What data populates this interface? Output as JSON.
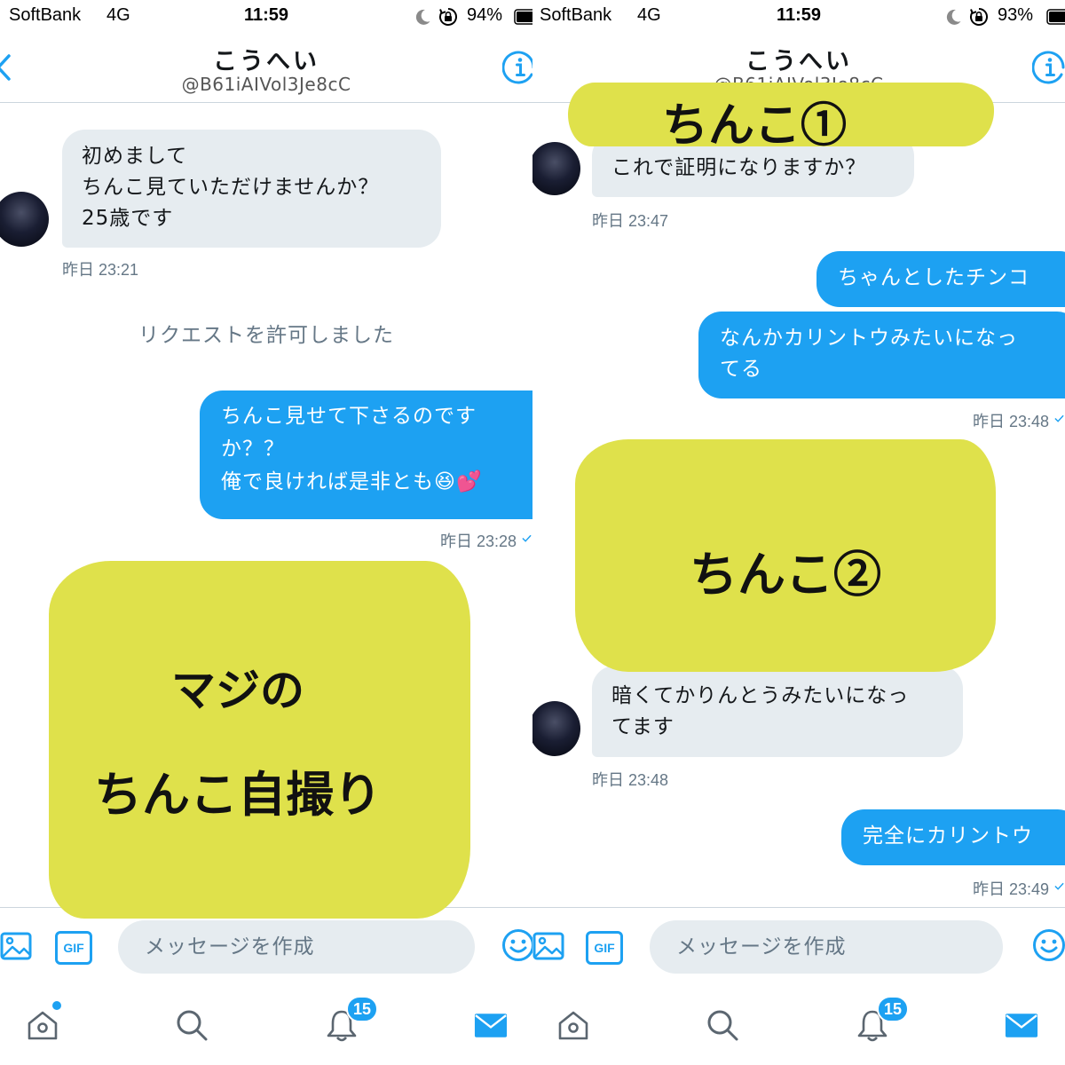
{
  "colors": {
    "accent": "#1da1f2",
    "incoming_bubble": "#e6ecf0",
    "highlighter": "#dfe14b",
    "secondary_text": "#657786"
  },
  "left_screen": {
    "status_bar": {
      "carrier": "SoftBank",
      "network": "4G",
      "time": "11:59",
      "battery": "94%"
    },
    "header": {
      "name": "こうへい",
      "handle": "@B61iAIVol3Je8cC"
    },
    "messages": [
      {
        "from_me": false,
        "lines": [
          "初めまして",
          "ちんこ見ていただけませんか？",
          "25歳です"
        ],
        "timestamp": "昨日 23:21"
      },
      {
        "system_text": "リクエストを許可しました"
      },
      {
        "from_me": true,
        "lines": [
          "ちんこ見せて下さるのです",
          "か？？",
          "俺で良ければ是非とも😆💕"
        ],
        "timestamp": "昨日 23:28",
        "status_icon": "sent-check-icon"
      }
    ],
    "highlighter_labels": [
      "マジの",
      "ちんこ自撮り"
    ],
    "composer": {
      "placeholder": "メッセージを作成",
      "gif_label": "GIF"
    },
    "tab_bar": {
      "notifications_badge": "15"
    }
  },
  "right_screen": {
    "status_bar": {
      "carrier": "SoftBank",
      "network": "4G",
      "time": "11:59",
      "battery": "93%"
    },
    "header": {
      "name": "こうへい",
      "handle": "@B61iAIVol3Je8cC"
    },
    "messages": [
      {
        "from_me": false,
        "lines": [
          "これで証明になりますか？"
        ],
        "timestamp": "昨日 23:47"
      },
      {
        "from_me": true,
        "lines": [
          "ちゃんとしたチンコ"
        ]
      },
      {
        "from_me": true,
        "lines": [
          "なんかカリントウみたいになっ",
          "てる"
        ],
        "timestamp": "昨日 23:48",
        "status_icon": "sent-check-icon"
      },
      {
        "from_me": false,
        "lines": [
          "暗くてかりんとうみたいになっ",
          "てます"
        ],
        "timestamp": "昨日 23:48"
      },
      {
        "from_me": true,
        "lines": [
          "完全にカリントウ"
        ],
        "timestamp": "昨日 23:49",
        "status_icon": "sent-check-icon"
      }
    ],
    "highlighter_labels": [
      "ちんこ①",
      "ちんこ②"
    ],
    "composer": {
      "placeholder": "メッセージを作成",
      "gif_label": "GIF"
    },
    "tab_bar": {
      "notifications_badge": "15"
    }
  }
}
